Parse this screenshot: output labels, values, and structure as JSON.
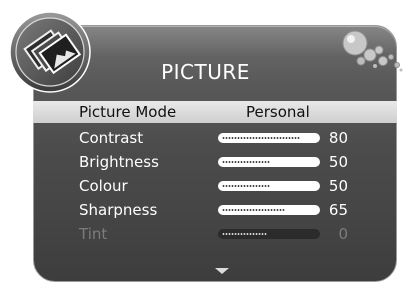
{
  "menu": {
    "title": "PICTURE",
    "items": [
      {
        "label": "Picture Mode",
        "value": "Personal"
      },
      {
        "label": "Contrast",
        "value": "80",
        "level": 80
      },
      {
        "label": "Brightness",
        "value": "50",
        "level": 50
      },
      {
        "label": "Colour",
        "value": "50",
        "level": 50
      },
      {
        "label": "Sharpness",
        "value": "65",
        "level": 65
      },
      {
        "label": "Tint",
        "value": "0",
        "level": 50
      }
    ]
  },
  "icons": {
    "logo": "picture-mode-icon",
    "decoration": "bubbles-icon",
    "more": "scroll-down-arrow-icon"
  },
  "colors": {
    "panel": "#4b4b4b",
    "highlight": "#d9d9d9",
    "text": "#ffffff",
    "disabled_text": "#7c7c7c"
  }
}
